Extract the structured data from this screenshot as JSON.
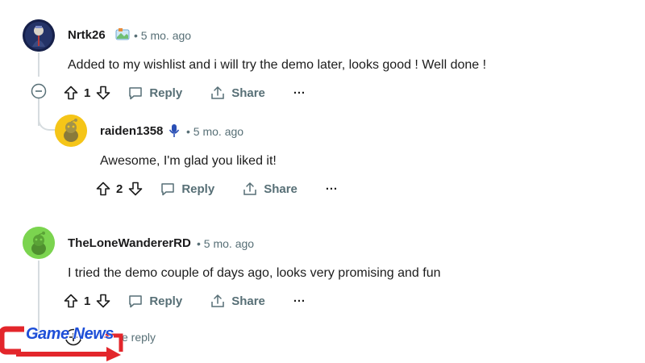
{
  "comments": [
    {
      "username": "Nrtk26",
      "time": "5 mo. ago",
      "text": "Added to my wishlist and i will try the demo later, looks good ! Well done !",
      "votes": "1",
      "reply_label": "Reply",
      "share_label": "Share",
      "more_label": "···",
      "flair_icon": "map-flair-icon"
    },
    {
      "username": "raiden1358",
      "time": "5 mo. ago",
      "text": "Awesome, I'm glad you liked it!",
      "votes": "2",
      "reply_label": "Reply",
      "share_label": "Share",
      "more_label": "···",
      "flair_icon": "microphone-icon"
    },
    {
      "username": "TheLoneWandererRD",
      "time": "5 mo. ago",
      "text": "I tried the demo couple of days ago, looks very promising and fun",
      "votes": "1",
      "reply_label": "Reply",
      "share_label": "Share",
      "more_label": "···"
    }
  ],
  "more_replies": {
    "label": "e reply"
  },
  "watermark": {
    "text": "Game News",
    "color": "#e3262b",
    "accent": "#1e4fd8"
  },
  "separator": "•"
}
